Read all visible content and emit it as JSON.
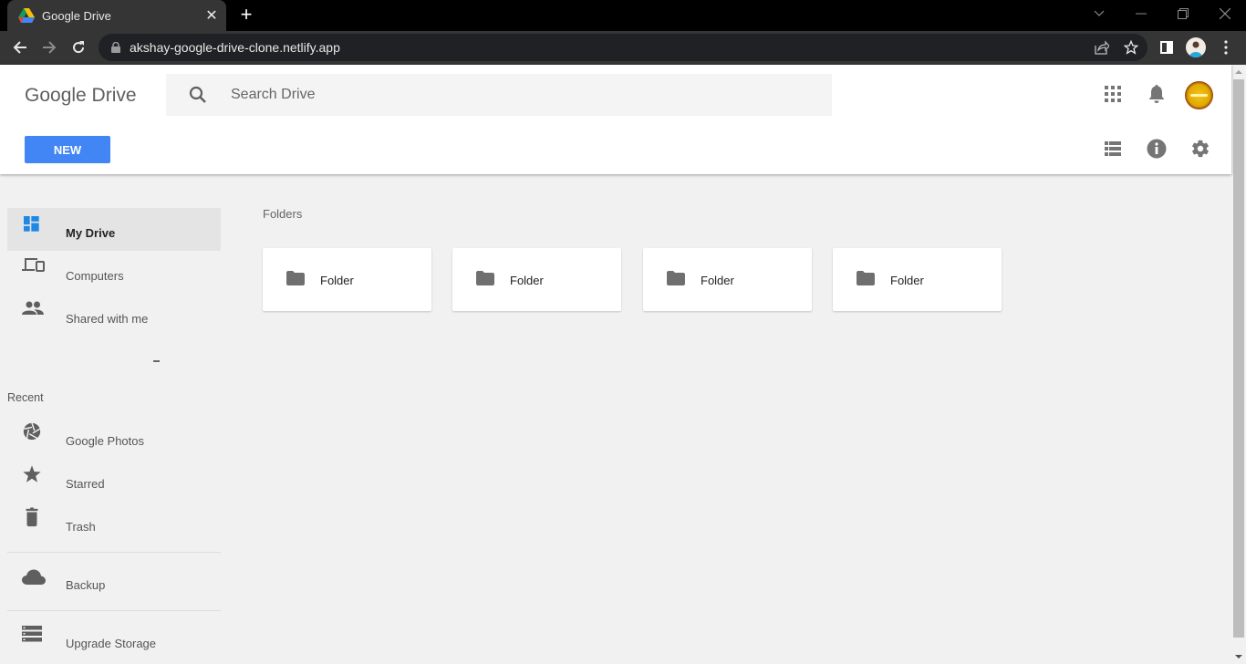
{
  "browser": {
    "tab_title": "Google Drive",
    "new_tab_label": "+",
    "url": "akshay-google-drive-clone.netlify.app"
  },
  "header": {
    "logo": "Google Drive",
    "search_placeholder": "Search Drive",
    "search_value": "",
    "new_button": "NEW",
    "accent_color": "#4285f4"
  },
  "sidebar": {
    "items": [
      {
        "label": "My Drive",
        "icon": "my-drive-icon",
        "active": true
      },
      {
        "label": "Computers",
        "icon": "computers-icon"
      },
      {
        "label": "Shared with me",
        "icon": "people-icon"
      }
    ],
    "recent_label": "Recent",
    "recent_items": [
      {
        "label": "Google Photos",
        "icon": "photos-icon"
      },
      {
        "label": "Starred",
        "icon": "star-icon"
      },
      {
        "label": "Trash",
        "icon": "trash-icon"
      }
    ],
    "backup": {
      "label": "Backup",
      "icon": "cloud-icon"
    },
    "storage": {
      "label": "Upgrade Storage",
      "icon": "storage-icon"
    }
  },
  "main": {
    "section_title": "Folders",
    "folders": [
      {
        "name": "Folder"
      },
      {
        "name": "Folder"
      },
      {
        "name": "Folder"
      },
      {
        "name": "Folder"
      }
    ]
  }
}
